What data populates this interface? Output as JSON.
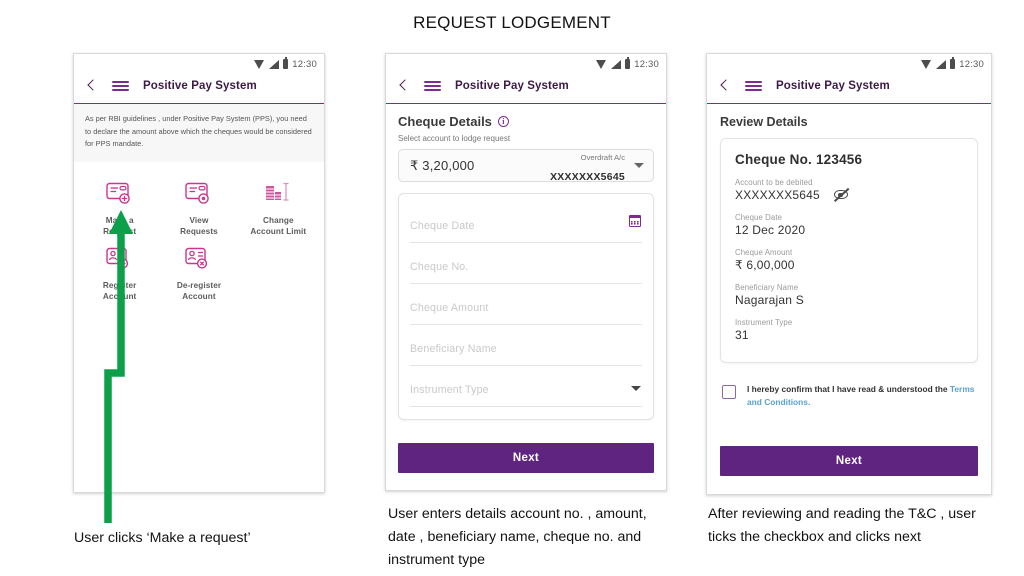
{
  "slide": {
    "title": "REQUEST LODGEMENT"
  },
  "statusbar": {
    "time": "12:30",
    "icons": [
      "wifi-icon",
      "signal-icon",
      "battery-icon"
    ]
  },
  "appbar": {
    "title": "Positive Pay System",
    "back": "back-chevron-icon",
    "menu": "hamburger-icon"
  },
  "colors": {
    "brand_purple": "#5f2480",
    "brand_magenta": "#a81f62",
    "icon_pink": "#c9368e",
    "arrow_green": "#0da04a",
    "link_blue": "#5aa2d0"
  },
  "phone1": {
    "notice": "As per RBI guidelines , under Positive Pay System (PPS), you need to declare the amount above which the cheques would be considered for PPS mandate.",
    "tiles": [
      {
        "label": "Make a\nRequest",
        "icon": "card-plus-icon"
      },
      {
        "label": "View\nRequests",
        "icon": "card-eye-icon"
      },
      {
        "label": "Change\nAccount Limit",
        "icon": "coins-limit-icon"
      },
      {
        "label": "Register\nAccount",
        "icon": "person-card-plus-icon"
      },
      {
        "label": "De-register\nAccount",
        "icon": "person-card-cross-icon"
      }
    ]
  },
  "phone2": {
    "section_title": "Cheque Details",
    "info_icon": "info-circle-icon",
    "sub_label": "Select account to lodge request",
    "account": {
      "amount": "₹ 3,20,000",
      "type": "Overdraft A/c",
      "number": "XXXXXXX5645",
      "caret": "chevron-down-icon"
    },
    "fields": [
      {
        "placeholder": "Cheque Date",
        "value": "",
        "trailing_icon": "calendar-icon"
      },
      {
        "placeholder": "Cheque No.",
        "value": "",
        "trailing_icon": ""
      },
      {
        "placeholder": "Cheque Amount",
        "value": "",
        "trailing_icon": ""
      },
      {
        "placeholder": "Beneficiary Name",
        "value": "",
        "trailing_icon": ""
      },
      {
        "placeholder": "Instrument Type",
        "value": "",
        "trailing_icon": "chevron-down-icon"
      }
    ],
    "next_label": "Next"
  },
  "phone3": {
    "review_title": "Review Details",
    "cheque_heading": "Cheque No. 123456",
    "details": [
      {
        "key": "Account to be debited",
        "value": "XXXXXXX5645",
        "icon": "eye-off-icon"
      },
      {
        "key": "Cheque Date",
        "value": "12 Dec 2020",
        "icon": ""
      },
      {
        "key": "Cheque Amount",
        "value": "₹ 6,00,000",
        "icon": ""
      },
      {
        "key": "Beneficiary Name",
        "value": "Nagarajan S",
        "icon": ""
      },
      {
        "key": "Instrument Type",
        "value": "31",
        "icon": ""
      }
    ],
    "consent": {
      "text_before": "I hereby confirm that I have read & understood the ",
      "link": "Terms and Conditions.",
      "checked": false
    },
    "next_label": "Next"
  },
  "captions": {
    "one": "User clicks ‘Make a request’",
    "two": "User enters details account no. , amount, date , beneficiary name, cheque no. and instrument type",
    "three": "After reviewing  and reading the T&C , user ticks the checkbox and clicks next"
  },
  "annotation": {
    "arrow": "green-flow-arrow"
  }
}
